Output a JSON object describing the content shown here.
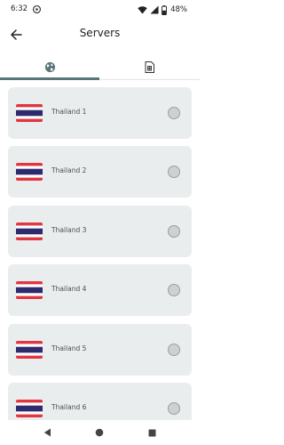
{
  "status_bar": {
    "time": "6:32",
    "battery_percent": "48%",
    "icons": [
      "sync-icon",
      "wifi-icon",
      "signal-icon",
      "battery-icon"
    ]
  },
  "header": {
    "title": "Servers",
    "back_icon": "arrow-back-icon"
  },
  "tabs": [
    {
      "icon": "globe-icon",
      "selected": true
    },
    {
      "icon": "sim-card-icon",
      "selected": false
    }
  ],
  "servers": [
    {
      "name": "Thailand 1",
      "flag": "thailand-flag",
      "selected": false
    },
    {
      "name": "Thailand 2",
      "flag": "thailand-flag",
      "selected": false
    },
    {
      "name": "Thailand 3",
      "flag": "thailand-flag",
      "selected": false
    },
    {
      "name": "Thailand 4",
      "flag": "thailand-flag",
      "selected": false
    },
    {
      "name": "Thailand 5",
      "flag": "thailand-flag",
      "selected": false
    },
    {
      "name": "Thailand 6",
      "flag": "thailand-flag",
      "selected": false
    }
  ],
  "nav_bar": {
    "icons": [
      "nav-back-icon",
      "nav-home-icon",
      "nav-recents-icon"
    ]
  },
  "colors": {
    "tab_indicator": "#5a7479",
    "card_background": "#eaedee",
    "flag_red": "#e0363f",
    "flag_blue": "#2d2a6e"
  }
}
